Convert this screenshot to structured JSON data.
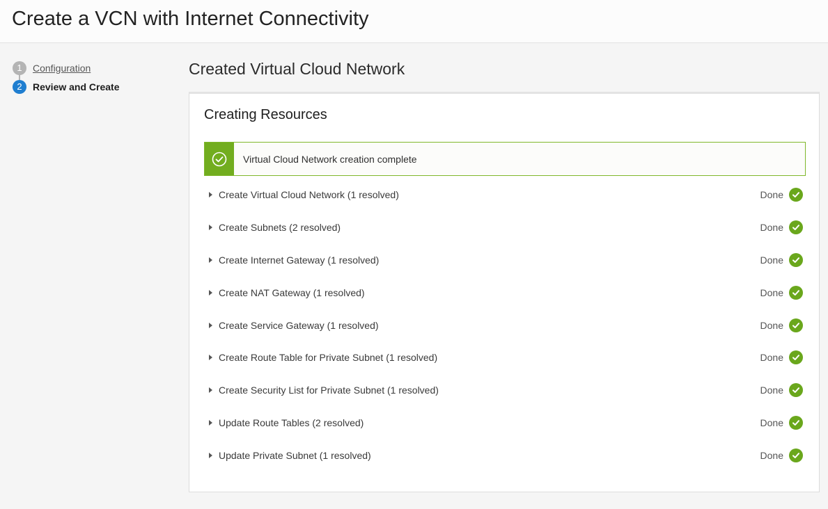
{
  "header": {
    "title": "Create a VCN with Internet Connectivity"
  },
  "steps": [
    {
      "number": "1",
      "label": "Configuration"
    },
    {
      "number": "2",
      "label": "Review and Create"
    }
  ],
  "main": {
    "title": "Created Virtual Cloud Network",
    "panel_title": "Creating Resources",
    "alert": {
      "text": "Virtual Cloud Network creation complete",
      "icon": "check-circle-icon"
    }
  },
  "resources": [
    {
      "label": "Create Virtual Cloud Network (1 resolved)",
      "status": "Done"
    },
    {
      "label": "Create Subnets (2 resolved)",
      "status": "Done"
    },
    {
      "label": "Create Internet Gateway (1 resolved)",
      "status": "Done"
    },
    {
      "label": "Create NAT Gateway (1 resolved)",
      "status": "Done"
    },
    {
      "label": "Create Service Gateway (1 resolved)",
      "status": "Done"
    },
    {
      "label": "Create Route Table for Private Subnet (1 resolved)",
      "status": "Done"
    },
    {
      "label": "Create Security List for Private Subnet (1 resolved)",
      "status": "Done"
    },
    {
      "label": "Update Route Tables (2 resolved)",
      "status": "Done"
    },
    {
      "label": "Update Private Subnet (1 resolved)",
      "status": "Done"
    }
  ],
  "colors": {
    "accent": "#1f7ed0",
    "success": "#6aa71c",
    "alert_border": "#7fb72a"
  }
}
